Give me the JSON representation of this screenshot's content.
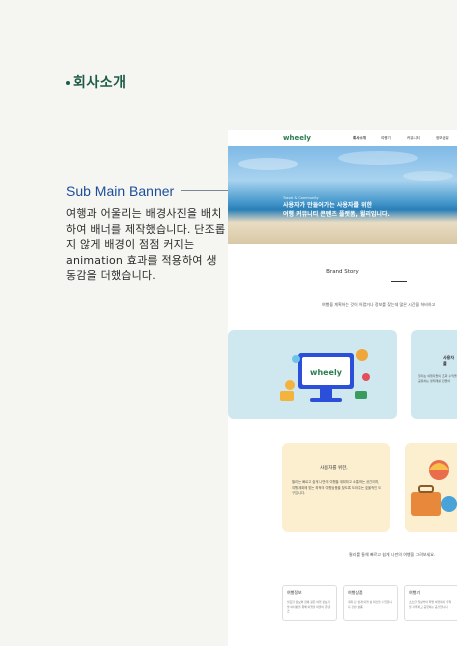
{
  "heading": "회사소개",
  "subtitle": "Sub Main Banner",
  "description": "여행과 어울리는 배경사진을 배치하여 배너를 제작했습니다. 단조롭지 않게 배경이 점점 커지는 animation 효과를 적용하여 생동감을 더했습니다.",
  "mockup": {
    "logo": "wheely",
    "nav": [
      "회사소개",
      "여행기",
      "커뮤니티",
      "정보공유"
    ],
    "hero_small": "Travel & Community",
    "hero_line1": "사용자가 만들어가는 사용자를 위한",
    "hero_line2": "여행 커뮤니티 콘텐츠 플랫폼, 윌리입니다.",
    "brand_story": "Brand Story",
    "brand_intro": "여행을 계획하는 것이 어렵거나 정보를 찾는데 많은 시간을 허비하고",
    "card_blue_logo": "wheely",
    "card_side_title": "사용자를",
    "card_side_desc": "윌리는 여행자들의 조화 수익을 공유하는 생태계를 만들어",
    "card_yellow_title": "사용자를 위한,",
    "card_yellow_desc": "윌리는 빠르고 쉽게 나만의 여행을 계획하고 소통하는 공간이며, 여행계획에 맞는 최적의 여행상품을 찾도록 도와주는 효율적인 도구입니다.",
    "tagline": "윌리를 통해 빠르고 쉽게 나만의 여행을 그려보세요.",
    "cards": [
      {
        "title": "여행정보",
        "desc": "필요한 정보와 함께 정든 여행 정보가 팔 여러분을 위해 여행을 떠올리 콘텐츠"
      },
      {
        "title": "여행상품",
        "desc": "계획 단 쉽게 여행 상 최신을 수입합니다 간편 상품"
      },
      {
        "title": "여행기",
        "desc": "소소한 일상부터 특별 여행까지 추억을 기록하고 공유하는 공간입니다"
      }
    ]
  }
}
